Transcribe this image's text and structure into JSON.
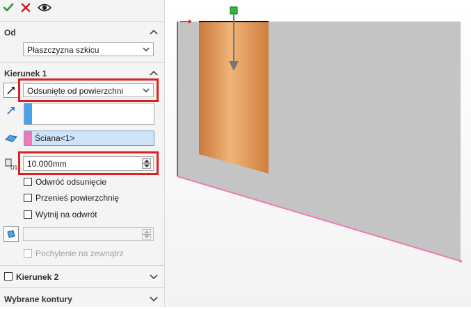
{
  "toolbar": {
    "ok_icon": "checkmark-icon",
    "cancel_icon": "x-icon",
    "preview_icon": "eye-icon"
  },
  "from": {
    "title": "Od",
    "start_value": "Płaszczyzna szkicu"
  },
  "direction1": {
    "title": "Kierunek 1",
    "end_condition": "Odsunięte od powierzchni",
    "face_item": "Ściana<1>",
    "offset_value": "10.000mm",
    "options": [
      {
        "label": "Odwróć odsunięcie",
        "checked": false
      },
      {
        "label": "Przenieś powierzchnię",
        "checked": false
      },
      {
        "label": "Wytnij na odwrót",
        "checked": false
      }
    ],
    "draft_outward_label": "Pochylenie na zewnątrz",
    "draft_outward_enabled": false
  },
  "direction2": {
    "title": "Kierunek 2",
    "checked": false
  },
  "selected_contours": {
    "title": "Wybrane kontury"
  },
  "colors": {
    "accent_blue": "#4aa3e8",
    "face_pink": "#f07ab8",
    "highlight_red": "#e02020",
    "extrude_orange": "#d98a3c",
    "plate_gray": "#c4c4c4"
  }
}
